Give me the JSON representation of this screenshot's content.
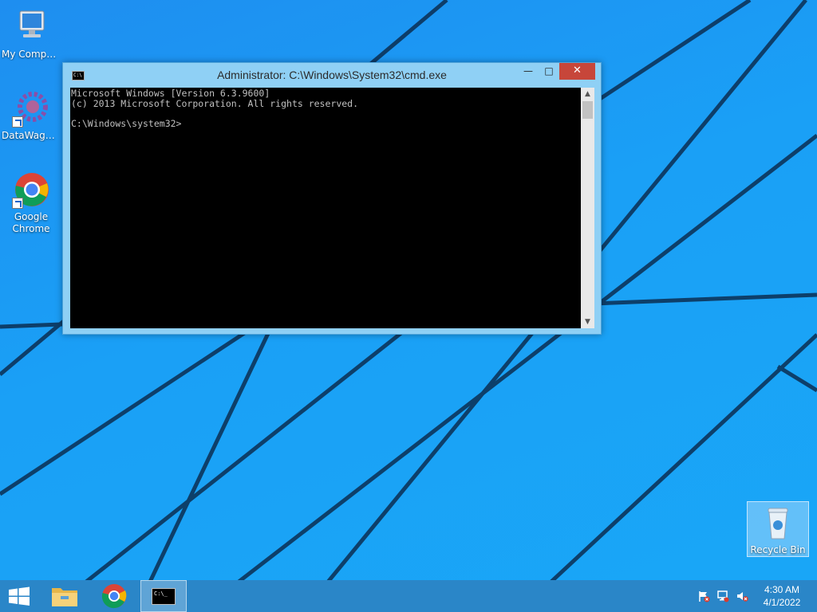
{
  "desktop": {
    "icons": [
      {
        "label": "My Computer"
      },
      {
        "label": "DataWagon..."
      },
      {
        "label": "Google Chrome"
      },
      {
        "label": "Recycle Bin"
      }
    ]
  },
  "cmd_window": {
    "title": "Administrator: C:\\Windows\\System32\\cmd.exe",
    "icon_text": "C:\\",
    "console_lines": "Microsoft Windows [Version 6.3.9600]\n(c) 2013 Microsoft Corporation. All rights reserved.\n\nC:\\Windows\\system32>",
    "buttons": {
      "minimize": "—",
      "maximize": "□",
      "close": "✕"
    }
  },
  "taskbar": {
    "apps": [
      {
        "icon": "windows-logo-icon"
      },
      {
        "icon": "file-explorer-icon"
      },
      {
        "icon": "chrome-icon"
      },
      {
        "icon": "cmd-icon",
        "text": "C:\\_"
      }
    ],
    "tray": {
      "icons": [
        "action-center-flag-icon",
        "network-icon",
        "volume-muted-icon"
      ],
      "time": "4:30 AM",
      "date": "4/1/2022"
    }
  },
  "colors": {
    "desktop_blue": "#1aa0f6",
    "window_frame": "#8fd0f5",
    "close_button": "#c7463a",
    "console_bg": "#000000",
    "console_text": "#c0c0c0"
  }
}
